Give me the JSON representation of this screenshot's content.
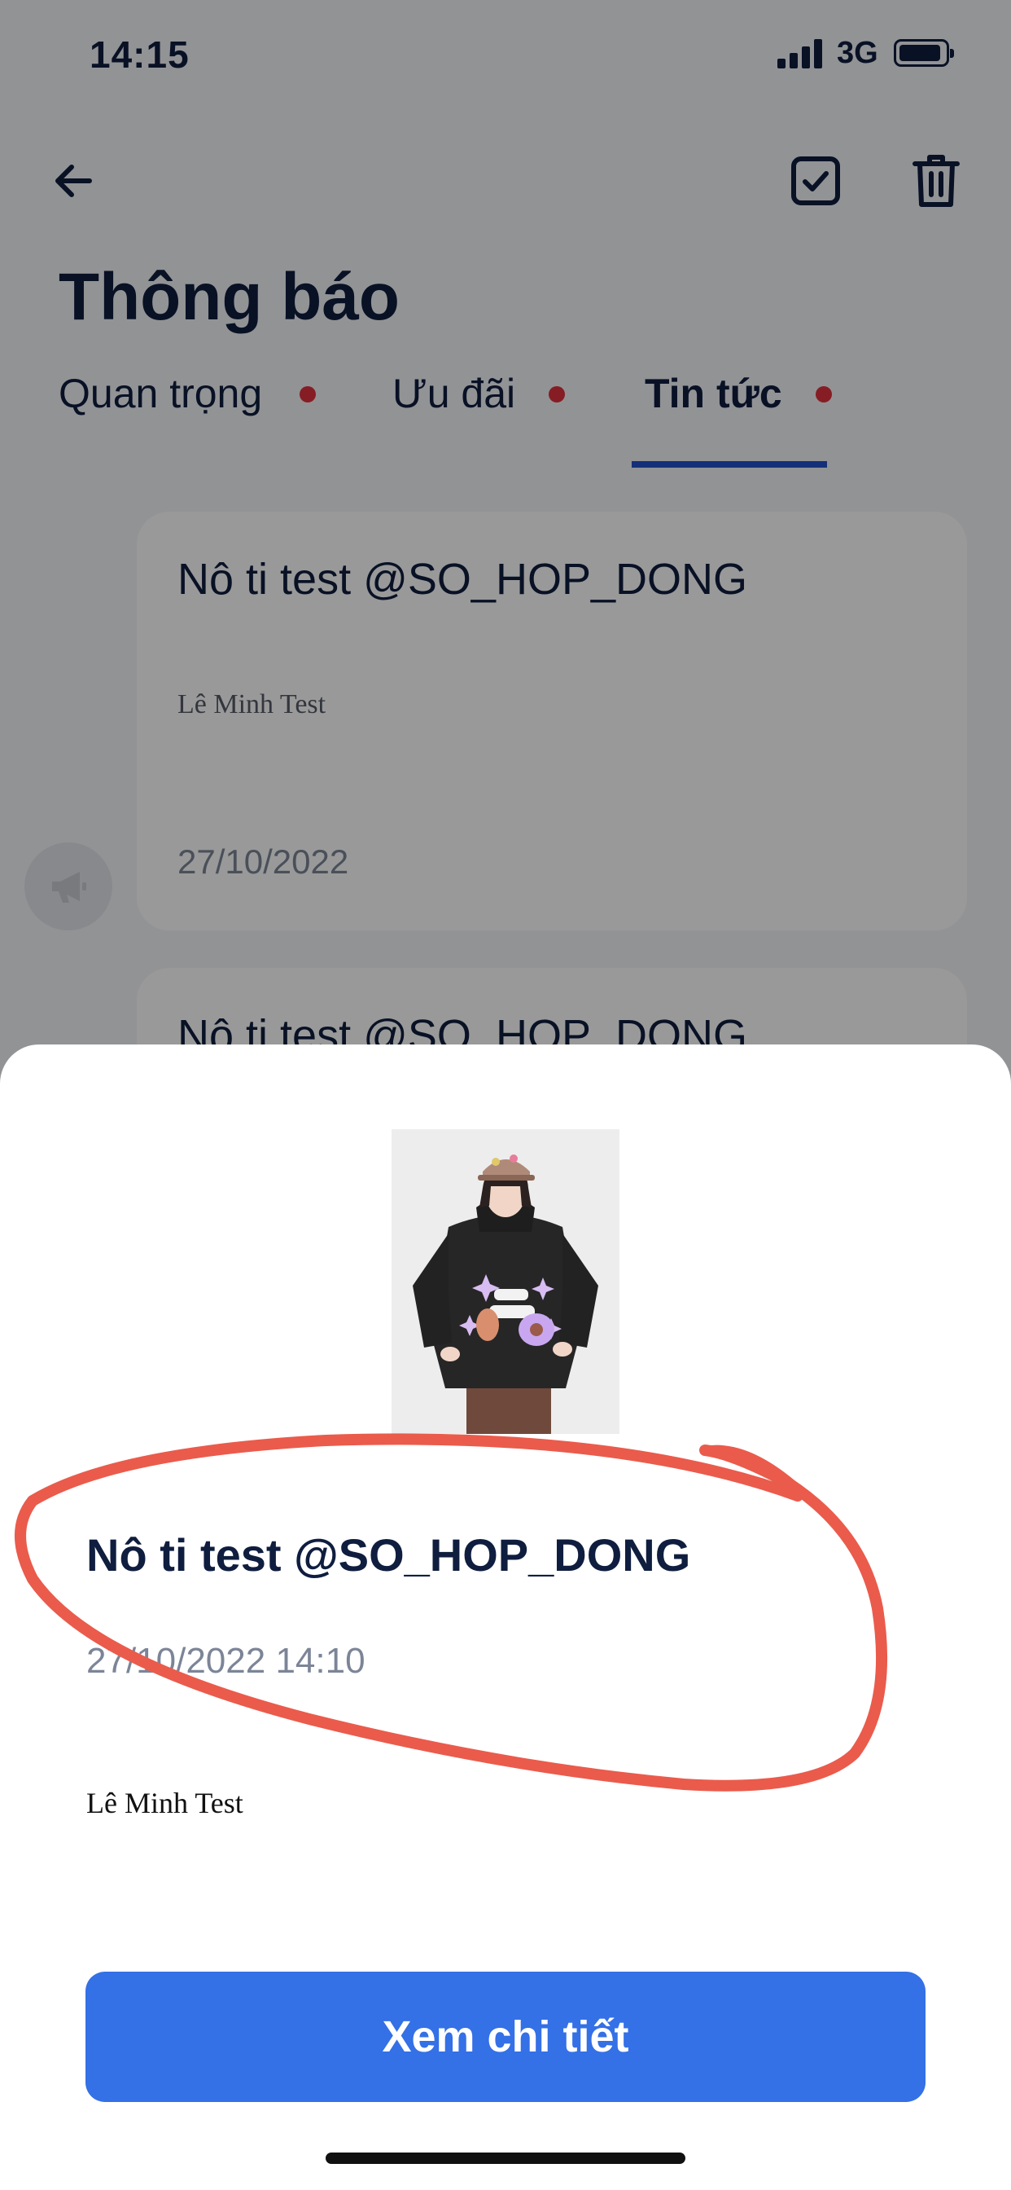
{
  "status_bar": {
    "time": "14:15",
    "network": "3G",
    "icons": [
      "signal-icon",
      "battery-icon"
    ]
  },
  "header": {
    "back_icon": "arrow-left-icon",
    "actions": [
      "checkbox-check-icon",
      "trash-icon"
    ],
    "title": "Thông báo",
    "tabs": [
      {
        "label": "Quan trọng",
        "unread_dot": true,
        "active": false
      },
      {
        "label": "Ưu đãi",
        "unread_dot": true,
        "active": false
      },
      {
        "label": "Tin tức",
        "unread_dot": true,
        "active": true
      }
    ]
  },
  "list": {
    "leading_icon": "megaphone-icon",
    "items": [
      {
        "title": "Nô ti test @SO_HOP_DONG",
        "body": "Lê Minh Test",
        "date": "27/10/2022"
      },
      {
        "title": "Nô ti test @SO_HOP_DONG"
      }
    ]
  },
  "sheet": {
    "image": "product-photo: person wearing black hoodie printed with local aliens",
    "title": "Nô ti test @SO_HOP_DONG",
    "datetime": "27/10/2022 14:10",
    "body": "Lê Minh Test",
    "button_label": "Xem chi tiết"
  },
  "colors": {
    "primary": "#3470e6",
    "title_text": "#0f1d3f",
    "unread_dot": "#e0313c",
    "tab_indicator": "#2451c8",
    "annotation": "#ea5b4c"
  }
}
